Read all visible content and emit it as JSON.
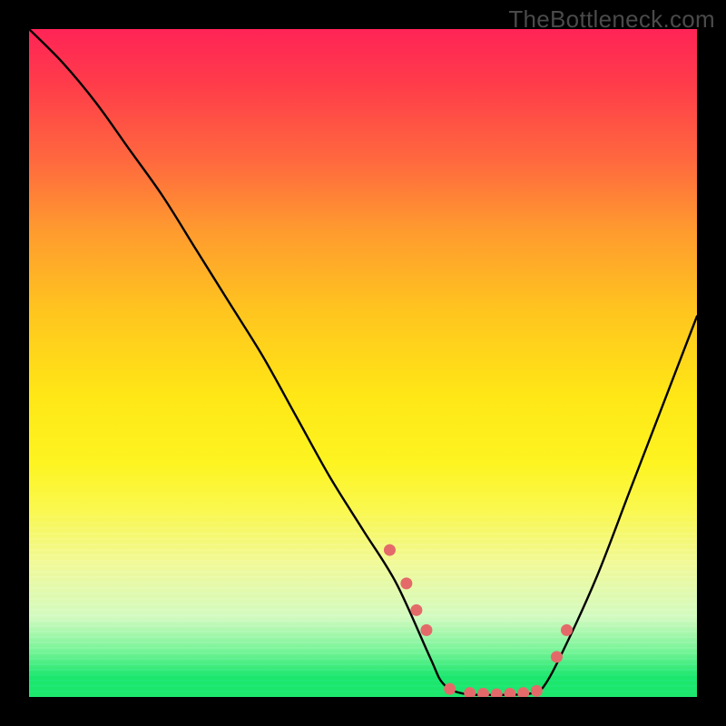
{
  "watermark": "TheBottleneck.com",
  "colors": {
    "gradient_top": "#ff2457",
    "gradient_mid": "#ffe716",
    "gradient_bottom": "#1de76f",
    "curve": "#000000",
    "marker_fill": "#e46a6a",
    "marker_stroke": "#b84f4f",
    "background": "#000000"
  },
  "chart_data": {
    "type": "line",
    "title": "",
    "xlabel": "",
    "ylabel": "",
    "xlim": [
      0,
      100
    ],
    "ylim": [
      0,
      100
    ],
    "grid": false,
    "legend": false,
    "note": "Axes are unlabeled; values are estimated in percent of plot width/height. Curve descends from top-left, reaches a flat minimum around x≈62–77, then rises toward upper-right. Salmon markers highlight points near the dip.",
    "series": [
      {
        "name": "bottleneck-curve",
        "x": [
          0,
          5,
          10,
          15,
          20,
          25,
          30,
          35,
          40,
          45,
          50,
          55,
          60,
          62,
          65,
          70,
          75,
          77,
          80,
          85,
          90,
          95,
          100
        ],
        "values": [
          100,
          95,
          89,
          82,
          75,
          67,
          59,
          51,
          42,
          33,
          25,
          17,
          6,
          2,
          0.5,
          0.3,
          0.5,
          1.5,
          7,
          18,
          31,
          44,
          57
        ]
      }
    ],
    "markers": {
      "name": "highlight-points",
      "x": [
        54,
        56.5,
        58,
        59.5,
        63,
        66,
        68,
        70,
        72,
        74,
        76,
        79,
        80.5
      ],
      "values": [
        22,
        17,
        13,
        10,
        1.2,
        0.6,
        0.5,
        0.4,
        0.5,
        0.6,
        0.9,
        6,
        10
      ]
    }
  }
}
